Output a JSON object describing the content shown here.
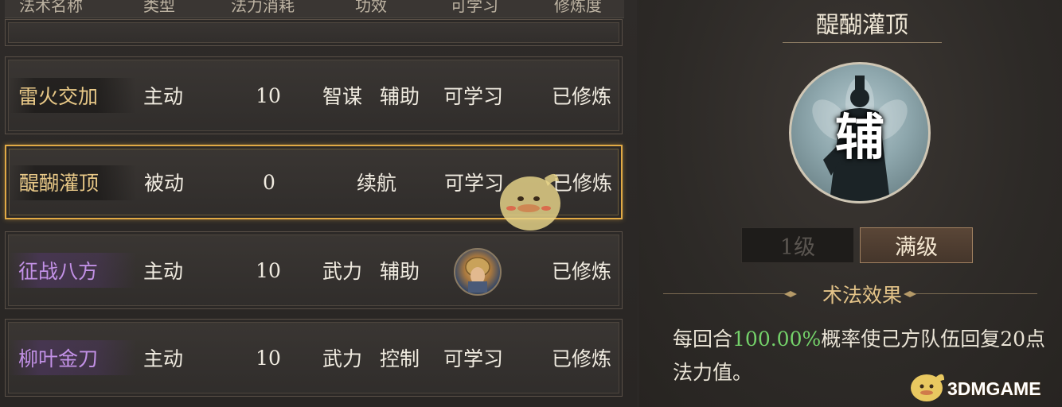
{
  "header": {
    "columns": [
      "法术名称",
      "类型",
      "法力消耗",
      "功效",
      "可学习",
      "修炼度"
    ]
  },
  "spells": [
    {
      "name": "雷火交加",
      "type": "主动",
      "cost": "10",
      "effect1": "智谋",
      "effect2": "辅助",
      "learn": "可学习",
      "practice": "已修炼",
      "name_color": "gold"
    },
    {
      "name": "醍醐灌顶",
      "type": "被动",
      "cost": "0",
      "effect": "续航",
      "learn": "可学习",
      "practice": "已修炼",
      "name_color": "gold",
      "selected": true
    },
    {
      "name": "征战八方",
      "type": "主动",
      "cost": "10",
      "effect1": "武力",
      "effect2": "辅助",
      "learn_icon": "general-portrait-avatar",
      "practice": "已修炼",
      "name_color": "purple"
    },
    {
      "name": "柳叶金刀",
      "type": "主动",
      "cost": "10",
      "effect1": "武力",
      "effect2": "控制",
      "learn": "可学习",
      "practice": "已修炼",
      "name_color": "purple"
    }
  ],
  "detail": {
    "title": "醍醐灌顶",
    "emblem_char": "辅",
    "level_1_label": "1级",
    "level_max_label": "满级",
    "effect_title": "术法效果",
    "effect_prefix": "每回合",
    "effect_highlight": "100.00%",
    "effect_suffix": "概率使己方队伍回复20点法力值。"
  },
  "watermark": {
    "text": "3DMGAME"
  },
  "colors": {
    "name_gold": "#e8c887",
    "name_purple": "#c291e6",
    "selected_border": "#e2aa45",
    "highlight_green": "#74d26a",
    "effect_title": "#e3c388"
  }
}
